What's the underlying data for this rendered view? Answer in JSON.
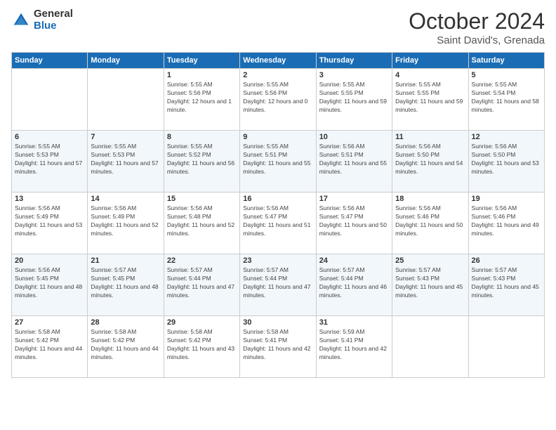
{
  "header": {
    "logo_general": "General",
    "logo_blue": "Blue",
    "month_title": "October 2024",
    "location": "Saint David's, Grenada"
  },
  "columns": [
    "Sunday",
    "Monday",
    "Tuesday",
    "Wednesday",
    "Thursday",
    "Friday",
    "Saturday"
  ],
  "weeks": [
    [
      {
        "day": "",
        "sunrise": "",
        "sunset": "",
        "daylight": ""
      },
      {
        "day": "",
        "sunrise": "",
        "sunset": "",
        "daylight": ""
      },
      {
        "day": "1",
        "sunrise": "Sunrise: 5:55 AM",
        "sunset": "Sunset: 5:56 PM",
        "daylight": "Daylight: 12 hours and 1 minute."
      },
      {
        "day": "2",
        "sunrise": "Sunrise: 5:55 AM",
        "sunset": "Sunset: 5:56 PM",
        "daylight": "Daylight: 12 hours and 0 minutes."
      },
      {
        "day": "3",
        "sunrise": "Sunrise: 5:55 AM",
        "sunset": "Sunset: 5:55 PM",
        "daylight": "Daylight: 11 hours and 59 minutes."
      },
      {
        "day": "4",
        "sunrise": "Sunrise: 5:55 AM",
        "sunset": "Sunset: 5:55 PM",
        "daylight": "Daylight: 11 hours and 59 minutes."
      },
      {
        "day": "5",
        "sunrise": "Sunrise: 5:55 AM",
        "sunset": "Sunset: 5:54 PM",
        "daylight": "Daylight: 11 hours and 58 minutes."
      }
    ],
    [
      {
        "day": "6",
        "sunrise": "Sunrise: 5:55 AM",
        "sunset": "Sunset: 5:53 PM",
        "daylight": "Daylight: 11 hours and 57 minutes."
      },
      {
        "day": "7",
        "sunrise": "Sunrise: 5:55 AM",
        "sunset": "Sunset: 5:53 PM",
        "daylight": "Daylight: 11 hours and 57 minutes."
      },
      {
        "day": "8",
        "sunrise": "Sunrise: 5:55 AM",
        "sunset": "Sunset: 5:52 PM",
        "daylight": "Daylight: 11 hours and 56 minutes."
      },
      {
        "day": "9",
        "sunrise": "Sunrise: 5:55 AM",
        "sunset": "Sunset: 5:51 PM",
        "daylight": "Daylight: 11 hours and 55 minutes."
      },
      {
        "day": "10",
        "sunrise": "Sunrise: 5:56 AM",
        "sunset": "Sunset: 5:51 PM",
        "daylight": "Daylight: 11 hours and 55 minutes."
      },
      {
        "day": "11",
        "sunrise": "Sunrise: 5:56 AM",
        "sunset": "Sunset: 5:50 PM",
        "daylight": "Daylight: 11 hours and 54 minutes."
      },
      {
        "day": "12",
        "sunrise": "Sunrise: 5:56 AM",
        "sunset": "Sunset: 5:50 PM",
        "daylight": "Daylight: 11 hours and 53 minutes."
      }
    ],
    [
      {
        "day": "13",
        "sunrise": "Sunrise: 5:56 AM",
        "sunset": "Sunset: 5:49 PM",
        "daylight": "Daylight: 11 hours and 53 minutes."
      },
      {
        "day": "14",
        "sunrise": "Sunrise: 5:56 AM",
        "sunset": "Sunset: 5:49 PM",
        "daylight": "Daylight: 11 hours and 52 minutes."
      },
      {
        "day": "15",
        "sunrise": "Sunrise: 5:56 AM",
        "sunset": "Sunset: 5:48 PM",
        "daylight": "Daylight: 11 hours and 52 minutes."
      },
      {
        "day": "16",
        "sunrise": "Sunrise: 5:56 AM",
        "sunset": "Sunset: 5:47 PM",
        "daylight": "Daylight: 11 hours and 51 minutes."
      },
      {
        "day": "17",
        "sunrise": "Sunrise: 5:56 AM",
        "sunset": "Sunset: 5:47 PM",
        "daylight": "Daylight: 11 hours and 50 minutes."
      },
      {
        "day": "18",
        "sunrise": "Sunrise: 5:56 AM",
        "sunset": "Sunset: 5:46 PM",
        "daylight": "Daylight: 11 hours and 50 minutes."
      },
      {
        "day": "19",
        "sunrise": "Sunrise: 5:56 AM",
        "sunset": "Sunset: 5:46 PM",
        "daylight": "Daylight: 11 hours and 49 minutes."
      }
    ],
    [
      {
        "day": "20",
        "sunrise": "Sunrise: 5:56 AM",
        "sunset": "Sunset: 5:45 PM",
        "daylight": "Daylight: 11 hours and 48 minutes."
      },
      {
        "day": "21",
        "sunrise": "Sunrise: 5:57 AM",
        "sunset": "Sunset: 5:45 PM",
        "daylight": "Daylight: 11 hours and 48 minutes."
      },
      {
        "day": "22",
        "sunrise": "Sunrise: 5:57 AM",
        "sunset": "Sunset: 5:44 PM",
        "daylight": "Daylight: 11 hours and 47 minutes."
      },
      {
        "day": "23",
        "sunrise": "Sunrise: 5:57 AM",
        "sunset": "Sunset: 5:44 PM",
        "daylight": "Daylight: 11 hours and 47 minutes."
      },
      {
        "day": "24",
        "sunrise": "Sunrise: 5:57 AM",
        "sunset": "Sunset: 5:44 PM",
        "daylight": "Daylight: 11 hours and 46 minutes."
      },
      {
        "day": "25",
        "sunrise": "Sunrise: 5:57 AM",
        "sunset": "Sunset: 5:43 PM",
        "daylight": "Daylight: 11 hours and 45 minutes."
      },
      {
        "day": "26",
        "sunrise": "Sunrise: 5:57 AM",
        "sunset": "Sunset: 5:43 PM",
        "daylight": "Daylight: 11 hours and 45 minutes."
      }
    ],
    [
      {
        "day": "27",
        "sunrise": "Sunrise: 5:58 AM",
        "sunset": "Sunset: 5:42 PM",
        "daylight": "Daylight: 11 hours and 44 minutes."
      },
      {
        "day": "28",
        "sunrise": "Sunrise: 5:58 AM",
        "sunset": "Sunset: 5:42 PM",
        "daylight": "Daylight: 11 hours and 44 minutes."
      },
      {
        "day": "29",
        "sunrise": "Sunrise: 5:58 AM",
        "sunset": "Sunset: 5:42 PM",
        "daylight": "Daylight: 11 hours and 43 minutes."
      },
      {
        "day": "30",
        "sunrise": "Sunrise: 5:58 AM",
        "sunset": "Sunset: 5:41 PM",
        "daylight": "Daylight: 11 hours and 42 minutes."
      },
      {
        "day": "31",
        "sunrise": "Sunrise: 5:59 AM",
        "sunset": "Sunset: 5:41 PM",
        "daylight": "Daylight: 11 hours and 42 minutes."
      },
      {
        "day": "",
        "sunrise": "",
        "sunset": "",
        "daylight": ""
      },
      {
        "day": "",
        "sunrise": "",
        "sunset": "",
        "daylight": ""
      }
    ]
  ]
}
